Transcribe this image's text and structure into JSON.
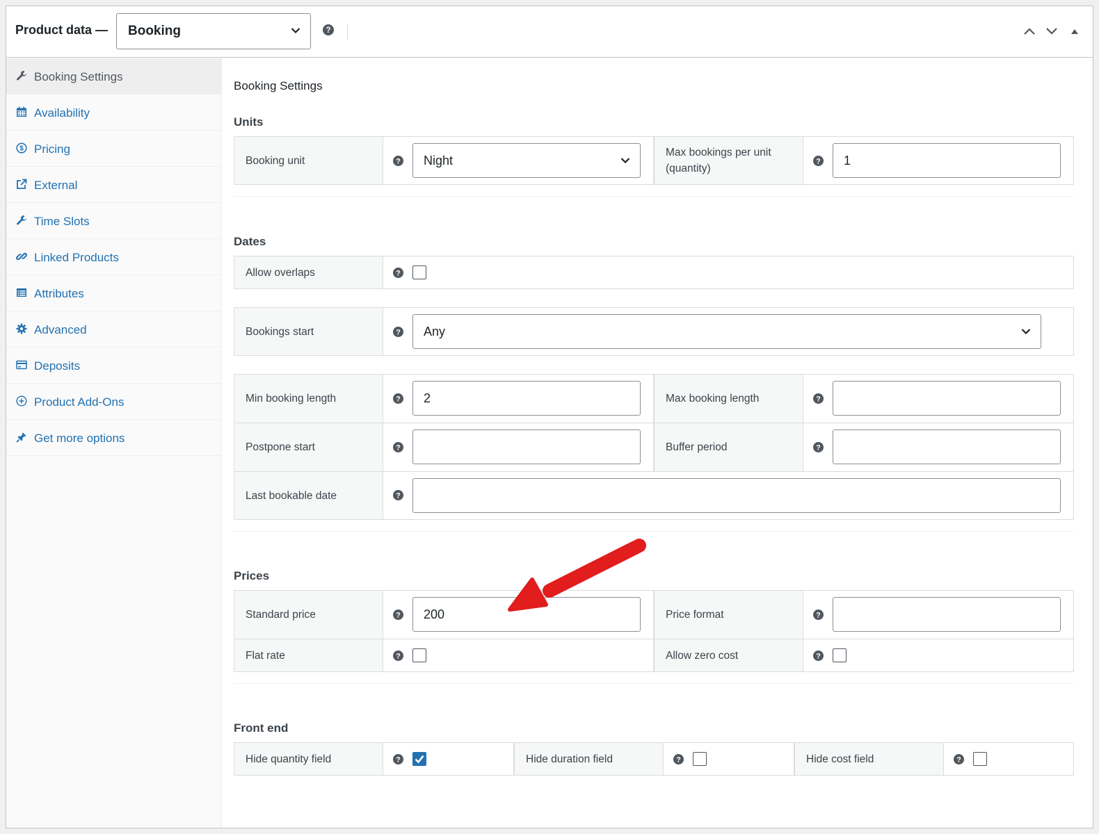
{
  "header": {
    "title": "Product data —",
    "product_type": "Booking"
  },
  "sidebar": {
    "items": [
      {
        "label": "Booking Settings",
        "icon": "wrench-icon"
      },
      {
        "label": "Availability",
        "icon": "calendar-icon"
      },
      {
        "label": "Pricing",
        "icon": "dollar-icon"
      },
      {
        "label": "External",
        "icon": "external-link-icon"
      },
      {
        "label": "Time Slots",
        "icon": "wrench-icon"
      },
      {
        "label": "Linked Products",
        "icon": "link-icon"
      },
      {
        "label": "Attributes",
        "icon": "list-icon"
      },
      {
        "label": "Advanced",
        "icon": "gear-icon"
      },
      {
        "label": "Deposits",
        "icon": "card-icon"
      },
      {
        "label": "Product Add-Ons",
        "icon": "plus-circle-icon"
      },
      {
        "label": "Get more options",
        "icon": "plugin-icon"
      }
    ]
  },
  "main": {
    "title": "Booking Settings",
    "units": {
      "heading": "Units",
      "booking_unit_label": "Booking unit",
      "booking_unit_value": "Night",
      "max_bookings_label": "Max bookings per unit (quantity)",
      "max_bookings_value": "1"
    },
    "dates": {
      "heading": "Dates",
      "allow_overlaps_label": "Allow overlaps",
      "bookings_start_label": "Bookings start",
      "bookings_start_value": "Any",
      "min_length_label": "Min booking length",
      "min_length_value": "2",
      "max_length_label": "Max booking length",
      "max_length_value": "",
      "postpone_label": "Postpone start",
      "postpone_value": "",
      "buffer_label": "Buffer period",
      "buffer_value": "",
      "last_date_label": "Last bookable date",
      "last_date_value": ""
    },
    "prices": {
      "heading": "Prices",
      "standard_price_label": "Standard price",
      "standard_price_value": "200",
      "price_format_label": "Price format",
      "price_format_value": "",
      "flat_rate_label": "Flat rate",
      "allow_zero_label": "Allow zero cost"
    },
    "front_end": {
      "heading": "Front end",
      "hide_quantity_label": "Hide quantity field",
      "hide_quantity_checked": true,
      "hide_duration_label": "Hide duration field",
      "hide_cost_label": "Hide cost field"
    }
  },
  "colors": {
    "link": "#2271b1",
    "annotation_arrow": "#e11d1d",
    "checkbox_on": "#2271b1"
  }
}
